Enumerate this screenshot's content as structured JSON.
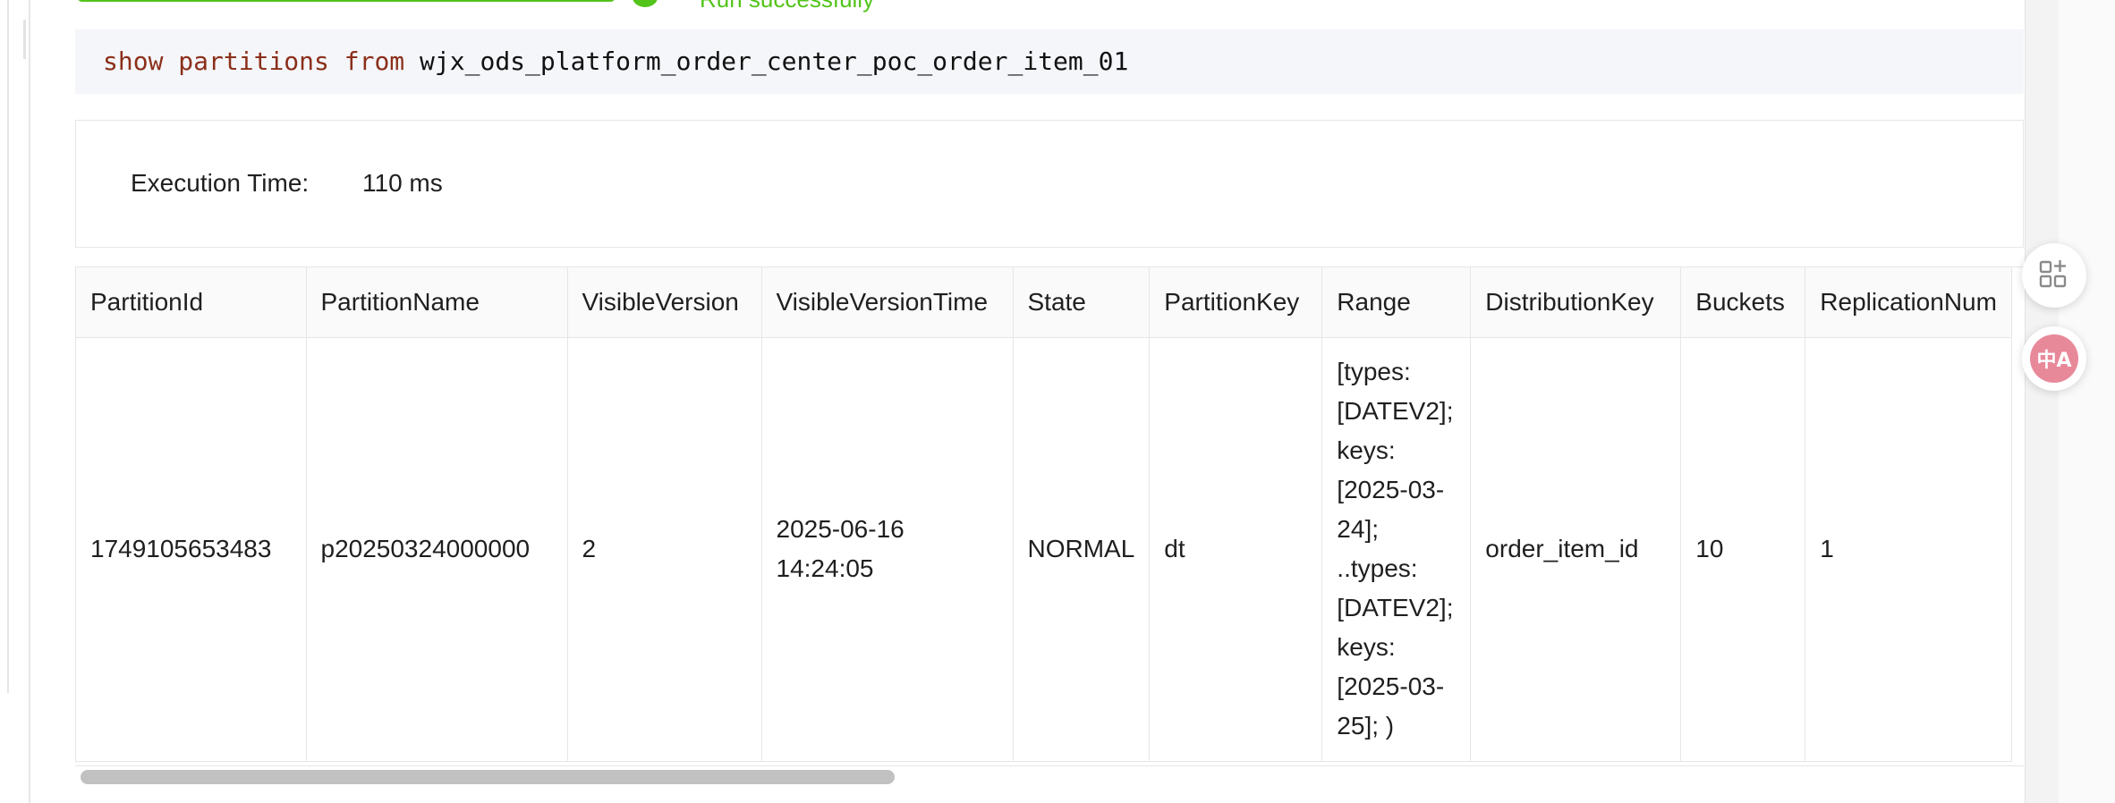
{
  "status": {
    "text": "Run successfully",
    "color": "#52c41a"
  },
  "query": {
    "kw1": "show",
    "kw2": "partitions",
    "kw3": "from",
    "table": "wjx_ods_platform_order_center_poc_order_item_01"
  },
  "execution": {
    "label": "Execution Time:",
    "value": "110 ms"
  },
  "table": {
    "columns": [
      "PartitionId",
      "PartitionName",
      "VisibleVersion",
      "VisibleVersionTime",
      "State",
      "PartitionKey",
      "Range",
      "DistributionKey",
      "Buckets",
      "ReplicationNum"
    ],
    "rows": [
      {
        "PartitionId": "1749105653483",
        "PartitionName": "p20250324000000",
        "VisibleVersion": "2",
        "VisibleVersionTime": "2025-06-16 14:24:05",
        "State": "NORMAL",
        "PartitionKey": "dt",
        "Range": "[types: [DATEV2]; keys: [2025-03-24]; ..types: [DATEV2]; keys: [2025-03-25]; )",
        "DistributionKey": "order_item_id",
        "Buckets": "10",
        "ReplicationNum": "1"
      }
    ]
  },
  "side_buttons": {
    "apps_icon": "apps-add-icon",
    "translate_icon": "translate-icon",
    "translate_glyph": "中A"
  }
}
